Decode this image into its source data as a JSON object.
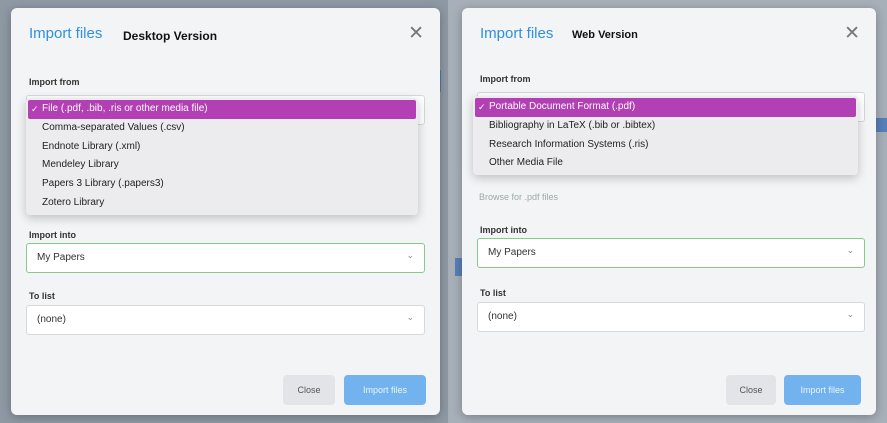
{
  "colors": {
    "accent": "#2f8fe0",
    "selection": "#b23fb4",
    "primary_button": "#72b2ef"
  },
  "desktop": {
    "title": "Import files",
    "subtitle": "Desktop Version",
    "import_from_label": "Import from",
    "options": [
      "File (.pdf, .bib, .ris or other media file)",
      "Comma-separated Values (.csv)",
      "Endnote Library (.xml)",
      "Mendeley Library",
      "Papers 3 Library (.papers3)",
      "Zotero Library"
    ],
    "selected_index": 0,
    "import_into_label": "Import into",
    "import_into_value": "My Papers",
    "to_list_label": "To list",
    "to_list_value": "(none)",
    "close_label": "Close",
    "import_label": "Import files"
  },
  "web": {
    "title": "Import files",
    "subtitle": "Web Version",
    "import_from_label": "Import from",
    "options": [
      "Portable Document Format (.pdf)",
      "Bibliography in LaTeX (.bib or .bibtex)",
      "Research Information Systems (.ris)",
      "Other Media File"
    ],
    "selected_index": 0,
    "browse_hint": "Browse for .pdf files",
    "import_into_label": "Import into",
    "import_into_value": "My Papers",
    "to_list_label": "To list",
    "to_list_value": "(none)",
    "close_label": "Close",
    "import_label": "Import files"
  }
}
